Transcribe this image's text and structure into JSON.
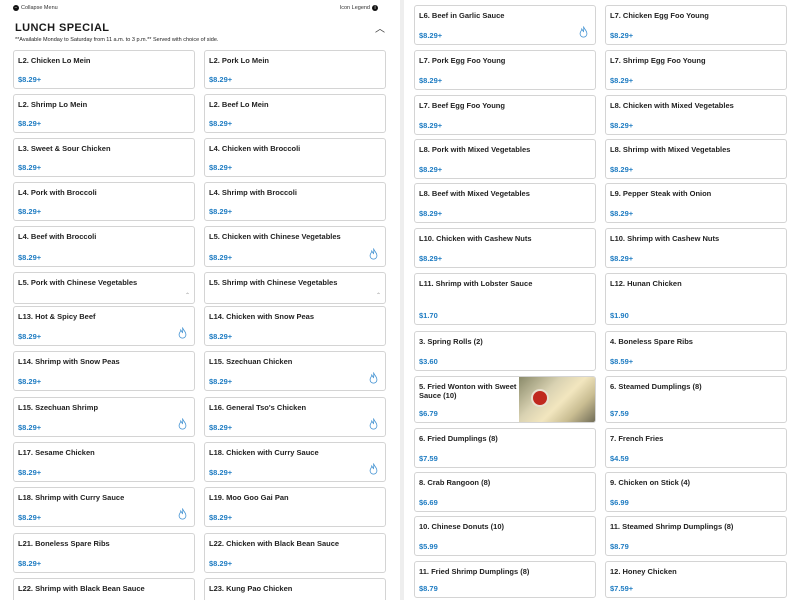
{
  "top": {
    "collapse_label": "Collapse Menu",
    "legend_label": "Icon Legend"
  },
  "section": {
    "title": "LUNCH SPECIAL",
    "subtitle": "**Available Monday to Saturday from 11 a.m. to 3 p.m.** Served with choice of side."
  },
  "colors": {
    "price": "#1f7cc2",
    "spicy_icon": "#3d8fd1"
  },
  "left_items": [
    {
      "name": "L2. Chicken Lo Mein",
      "price": "$8.29+"
    },
    {
      "name": "L2. Pork Lo Mein",
      "price": "$8.29+"
    },
    {
      "name": "L2. Shrimp Lo Mein",
      "price": "$8.29+"
    },
    {
      "name": "L2. Beef Lo Mein",
      "price": "$8.29+"
    },
    {
      "name": "L3. Sweet & Sour Chicken",
      "price": "$8.29+"
    },
    {
      "name": "L4. Chicken with Broccoli",
      "price": "$8.29+"
    },
    {
      "name": "L4. Pork with Broccoli",
      "price": "$8.29+"
    },
    {
      "name": "L4. Shrimp with Broccoli",
      "price": "$8.29+"
    },
    {
      "name": "L4. Beef with Broccoli",
      "price": "$8.29+"
    },
    {
      "name": "L5. Chicken with Chinese Vegetables",
      "price": "$8.29+"
    },
    {
      "name": "L5. Pork with Chinese Vegetables",
      "price": ""
    },
    {
      "name": "L5. Shrimp with Chinese Vegetables",
      "price": ""
    },
    {
      "name": "L13. Hot & Spicy Beef",
      "price": "$8.29+"
    },
    {
      "name": "L14. Chicken with Snow Peas",
      "price": "$8.29+"
    },
    {
      "name": "L14. Shrimp with Snow Peas",
      "price": "$8.29+"
    },
    {
      "name": "L15. Szechuan Chicken",
      "price": "$8.29+"
    },
    {
      "name": "L15. Szechuan Shrimp",
      "price": "$8.29+"
    },
    {
      "name": "L16. General Tso's Chicken",
      "price": "$8.29+"
    },
    {
      "name": "L17. Sesame Chicken",
      "price": "$8.29+"
    },
    {
      "name": "L18. Chicken with Curry Sauce",
      "price": "$8.29+"
    },
    {
      "name": "L18. Shrimp with Curry Sauce",
      "price": "$8.29+"
    },
    {
      "name": "L19. Moo Goo Gai Pan",
      "price": "$8.29+"
    },
    {
      "name": "L21. Boneless Spare Ribs",
      "price": "$8.29+"
    },
    {
      "name": "L22. Chicken with Black Bean Sauce",
      "price": "$8.29+"
    },
    {
      "name": "L22. Shrimp with Black Bean Sauce",
      "price": ""
    },
    {
      "name": "L23. Kung Pao Chicken",
      "price": ""
    }
  ],
  "right_items": [
    {
      "name": "L6. Beef in Garlic Sauce",
      "price": "$8.29+"
    },
    {
      "name": "L7. Chicken Egg Foo Young",
      "price": "$8.29+"
    },
    {
      "name": "L7. Pork Egg Foo Young",
      "price": "$8.29+"
    },
    {
      "name": "L7. Shrimp Egg Foo Young",
      "price": "$8.29+"
    },
    {
      "name": "L7. Beef Egg Foo Young",
      "price": "$8.29+"
    },
    {
      "name": "L8. Chicken with Mixed Vegetables",
      "price": "$8.29+"
    },
    {
      "name": "L8. Pork with Mixed Vegetables",
      "price": "$8.29+"
    },
    {
      "name": "L8. Shrimp with Mixed Vegetables",
      "price": "$8.29+"
    },
    {
      "name": "L8. Beef with Mixed Vegetables",
      "price": "$8.29+"
    },
    {
      "name": "L9. Pepper Steak with Onion",
      "price": "$8.29+"
    },
    {
      "name": "L10. Chicken with Cashew Nuts",
      "price": "$8.29+"
    },
    {
      "name": "L10. Shrimp with Cashew Nuts",
      "price": "$8.29+"
    },
    {
      "name": "L11. Shrimp with Lobster Sauce",
      "price": "$1.70"
    },
    {
      "name": "L12. Hunan Chicken",
      "price": "$1.90"
    },
    {
      "name": "3. Spring Rolls (2)",
      "price": "$3.60"
    },
    {
      "name": "4. Boneless Spare Ribs",
      "price": "$8.59+"
    },
    {
      "name": "5. Fried Wonton with Sweet Sauce (10)",
      "price": "$6.79"
    },
    {
      "name": "6. Steamed Dumplings (8)",
      "price": "$7.59"
    },
    {
      "name": "6. Fried Dumplings (8)",
      "price": "$7.59"
    },
    {
      "name": "7. French Fries",
      "price": "$4.59"
    },
    {
      "name": "8. Crab Rangoon (8)",
      "price": "$6.69"
    },
    {
      "name": "9. Chicken on Stick (4)",
      "price": "$6.99"
    },
    {
      "name": "10. Chinese Donuts (10)",
      "price": "$5.99"
    },
    {
      "name": "11. Steamed Shrimp Dumplings (8)",
      "price": "$8.79"
    },
    {
      "name": "11. Fried Shrimp Dumplings (8)",
      "price": "$8.79"
    },
    {
      "name": "12. Honey Chicken",
      "price": "$7.59+"
    }
  ]
}
